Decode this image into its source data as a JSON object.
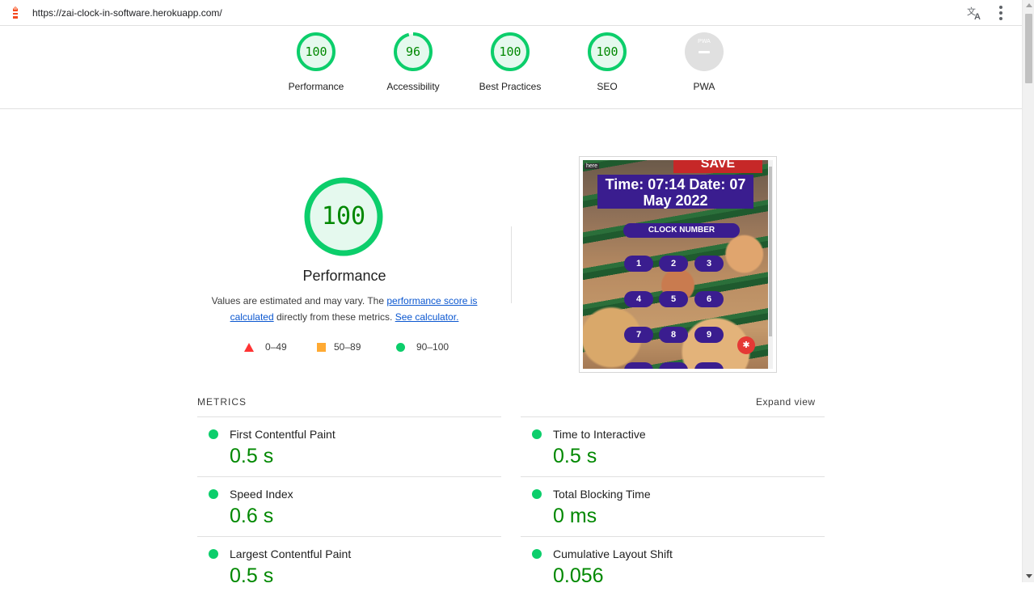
{
  "browser": {
    "url": "https://zai-clock-in-software.herokuapp.com/",
    "icons": [
      "lighthouse-icon",
      "translate-icon",
      "kebab-menu-icon"
    ]
  },
  "gauges": [
    {
      "score": "100",
      "label": "Performance",
      "fraction": 1.0
    },
    {
      "score": "96",
      "label": "Accessibility",
      "fraction": 0.96
    },
    {
      "score": "100",
      "label": "Best Practices",
      "fraction": 1.0
    },
    {
      "score": "100",
      "label": "SEO",
      "fraction": 1.0
    },
    {
      "score": "",
      "label": "PWA",
      "badge_text": "PWA"
    }
  ],
  "performance": {
    "score": "100",
    "title": "Performance",
    "desc_prefix": "Values are estimated and may vary. The ",
    "link1": "performance score is calculated",
    "desc_mid": " directly from these metrics. ",
    "link2": "See calculator."
  },
  "legend": [
    {
      "range": "0–49",
      "shape": "triangle",
      "color": "#ff3333"
    },
    {
      "range": "50–89",
      "shape": "square",
      "color": "#ffaa33"
    },
    {
      "range": "90–100",
      "shape": "circle",
      "color": "#0cce6b"
    }
  ],
  "thumbnail": {
    "sale": "SAVE",
    "here": "here",
    "time_line1": "Time: 07:14 Date: 07",
    "time_line2": "May 2022",
    "clock_button": "CLOCK NUMBER",
    "keys": [
      "1",
      "2",
      "3",
      "4",
      "5",
      "6",
      "7",
      "8",
      "9"
    ],
    "fab_icon": "gear-icon"
  },
  "metrics": {
    "heading": "METRICS",
    "expand": "Expand view",
    "items": [
      {
        "name": "First Contentful Paint",
        "value": "0.5 s"
      },
      {
        "name": "Time to Interactive",
        "value": "0.5 s"
      },
      {
        "name": "Speed Index",
        "value": "0.6 s"
      },
      {
        "name": "Total Blocking Time",
        "value": "0 ms"
      },
      {
        "name": "Largest Contentful Paint",
        "value": "0.5 s"
      },
      {
        "name": "Cumulative Layout Shift",
        "value": "0.056"
      }
    ]
  },
  "colors": {
    "pass": "#0cce6b",
    "pass_text": "#008800",
    "pass_bg": "#e5f9ee",
    "kiosk_purple": "#3a1d8f"
  }
}
